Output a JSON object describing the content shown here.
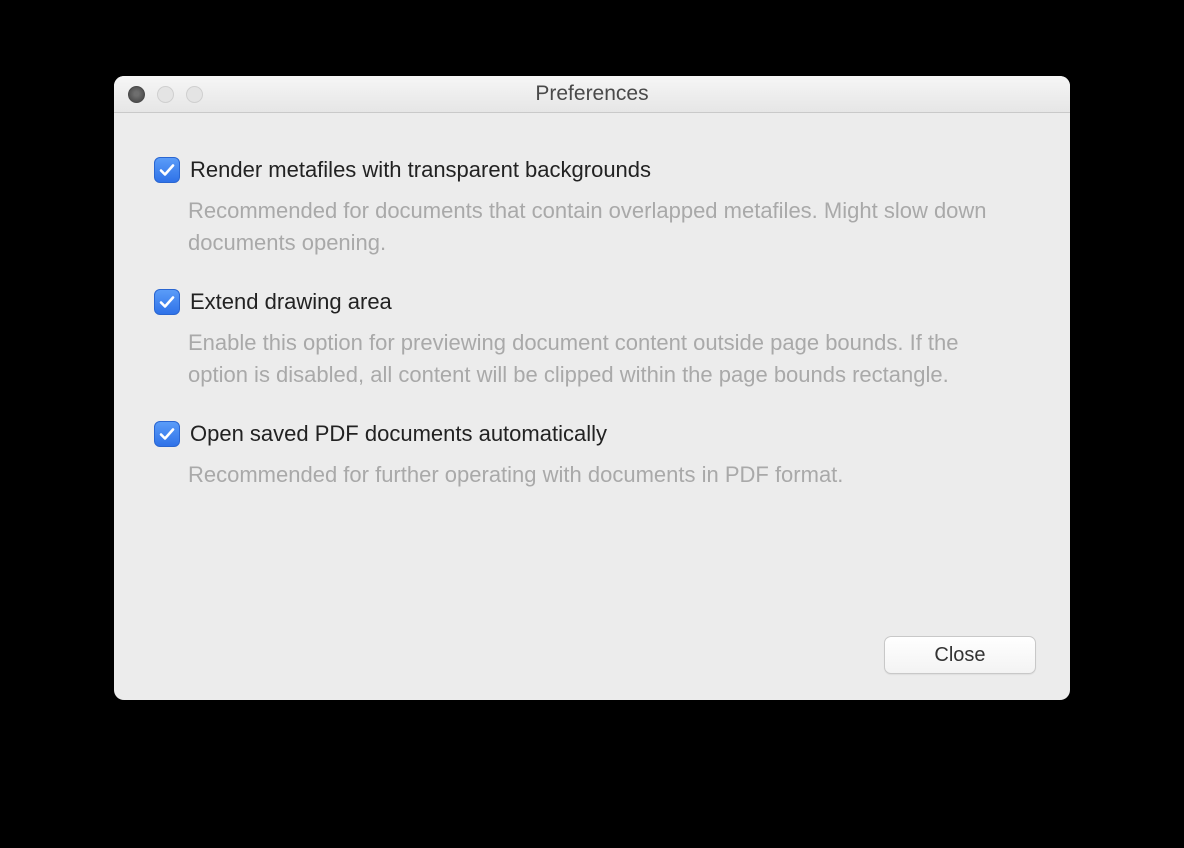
{
  "window": {
    "title": "Preferences"
  },
  "options": [
    {
      "checked": true,
      "label": "Render metafiles with transparent backgrounds",
      "description": "Recommended for documents that contain overlapped metafiles. Might slow down documents opening."
    },
    {
      "checked": true,
      "label": "Extend drawing area",
      "description": "Enable this option for previewing document content outside page bounds. If the option is disabled, all content will be clipped within the page bounds rectangle."
    },
    {
      "checked": true,
      "label": "Open saved PDF documents automatically",
      "description": "Recommended for further operating with documents in PDF format."
    }
  ],
  "buttons": {
    "close": "Close"
  }
}
